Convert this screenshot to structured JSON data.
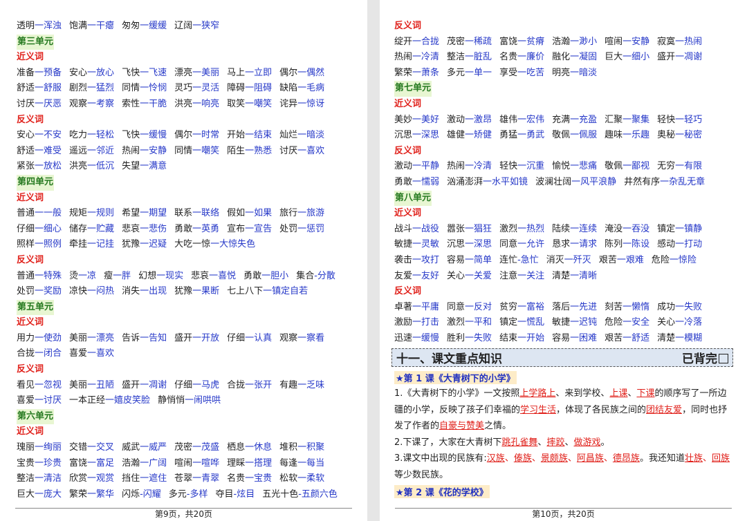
{
  "page9": {
    "footer": "第9页，共20页",
    "blocks": [
      {
        "kind": "words",
        "items": [
          [
            "透明",
            "一浑浊"
          ],
          [
            "饱满",
            "一干瘪"
          ],
          [
            "匆匆",
            "一缓缓"
          ],
          [
            "辽阔",
            "一狭窄"
          ]
        ]
      },
      {
        "kind": "unit",
        "text": "第三单元"
      },
      {
        "kind": "cat",
        "text": "近义词"
      },
      {
        "kind": "words",
        "items": [
          [
            "准备",
            "一预备"
          ],
          [
            "安心",
            "一放心"
          ],
          [
            "飞快",
            "一飞速"
          ],
          [
            "漂亮",
            "一美丽"
          ],
          [
            "马上",
            "一立即"
          ],
          [
            "偶尔",
            "一偶然"
          ]
        ]
      },
      {
        "kind": "words",
        "items": [
          [
            "舒适",
            "一舒服"
          ],
          [
            "剧烈",
            "一猛烈"
          ],
          [
            "同情",
            "一怜悯"
          ],
          [
            "灵巧",
            "一灵活"
          ],
          [
            "障碍",
            "一阻碍"
          ],
          [
            "缺陷",
            "一毛病"
          ]
        ]
      },
      {
        "kind": "words",
        "items": [
          [
            "讨厌",
            "一厌恶"
          ],
          [
            "观察",
            "一考察"
          ],
          [
            "索性",
            "一干脆"
          ],
          [
            "洪亮",
            "一响亮"
          ],
          [
            "取笑",
            "一嘲笑"
          ],
          [
            "诧异",
            "一惊讶"
          ]
        ]
      },
      {
        "kind": "cat",
        "text": "反义词"
      },
      {
        "kind": "words",
        "items": [
          [
            "安心",
            "一不安"
          ],
          [
            "吃力",
            "一轻松"
          ],
          [
            "飞快",
            "一缓慢"
          ],
          [
            "偶尔",
            "一时常"
          ],
          [
            "开始",
            "一结束"
          ],
          [
            "灿烂",
            "一暗淡"
          ]
        ]
      },
      {
        "kind": "words",
        "items": [
          [
            "舒适",
            "一难受"
          ],
          [
            "遥远",
            "一邻近"
          ],
          [
            "热闹",
            "一安静"
          ],
          [
            "同情",
            "一嘲笑"
          ],
          [
            "陌生",
            "一熟悉"
          ],
          [
            "讨厌",
            "一喜欢"
          ]
        ]
      },
      {
        "kind": "words",
        "items": [
          [
            "紧张",
            "一放松"
          ],
          [
            "洪亮",
            "一低沉"
          ],
          [
            "失望",
            "一满意"
          ]
        ]
      },
      {
        "kind": "unit",
        "text": "第四单元"
      },
      {
        "kind": "cat",
        "text": "近义词"
      },
      {
        "kind": "words",
        "items": [
          [
            "普通",
            "一一般"
          ],
          [
            "规矩",
            "一规则"
          ],
          [
            "希望",
            "一期望"
          ],
          [
            "联系",
            "一联络"
          ],
          [
            "假如",
            "一如果"
          ],
          [
            "旅行",
            "一旅游"
          ]
        ]
      },
      {
        "kind": "words",
        "items": [
          [
            "仔细",
            "一细心"
          ],
          [
            "储存",
            "一贮藏"
          ],
          [
            "悲哀",
            "一悲伤"
          ],
          [
            "勇敢",
            "一英勇"
          ],
          [
            "宣布",
            "一宣告"
          ],
          [
            "处罚",
            "一惩罚"
          ]
        ]
      },
      {
        "kind": "words",
        "items": [
          [
            "照样",
            "一照例"
          ],
          [
            "牵挂",
            "一记挂"
          ],
          [
            "犹豫",
            "一迟疑"
          ],
          [
            "大吃一惊",
            "一大惊失色"
          ]
        ]
      },
      {
        "kind": "cat",
        "text": "反义词"
      },
      {
        "kind": "words",
        "items": [
          [
            "普通",
            "一特殊"
          ],
          [
            "烫",
            "一凉"
          ],
          [
            "瘦",
            "一胖"
          ],
          [
            "幻想",
            "一现实"
          ],
          [
            "悲哀",
            "一喜悦"
          ],
          [
            "勇敢",
            "一胆小"
          ],
          [
            "集合",
            "-分散"
          ]
        ]
      },
      {
        "kind": "words",
        "items": [
          [
            "处罚",
            "一奖励"
          ],
          [
            "凉快",
            "一闷热"
          ],
          [
            "消失",
            "一出现"
          ],
          [
            "犹豫",
            "一果断"
          ],
          [
            "七上八下",
            "一镇定自若"
          ]
        ]
      },
      {
        "kind": "unit",
        "text": "第五单元"
      },
      {
        "kind": "cat",
        "text": "近义词"
      },
      {
        "kind": "words",
        "items": [
          [
            "用力",
            "一使劲"
          ],
          [
            "美丽",
            "一漂亮"
          ],
          [
            "告诉",
            "一告知"
          ],
          [
            "盛开",
            "一开放"
          ],
          [
            "仔细",
            "一认真"
          ],
          [
            "观察",
            "一察看"
          ]
        ]
      },
      {
        "kind": "words",
        "items": [
          [
            "合拢",
            "一闭合"
          ],
          [
            "喜爱",
            "一喜欢"
          ]
        ]
      },
      {
        "kind": "cat",
        "text": "反义词"
      },
      {
        "kind": "words",
        "items": [
          [
            "看见",
            "一忽视"
          ],
          [
            "美丽",
            "一丑陋"
          ],
          [
            "盛开",
            "一凋谢"
          ],
          [
            "仔细",
            "一马虎"
          ],
          [
            "合拢",
            "一张开"
          ],
          [
            "有趣",
            "一乏味"
          ]
        ]
      },
      {
        "kind": "words",
        "items": [
          [
            "喜爱",
            "一讨厌"
          ],
          [
            "一本正经",
            "一嬉皮笑脸"
          ],
          [
            "静悄悄",
            "一闹哄哄"
          ]
        ]
      },
      {
        "kind": "unit",
        "text": "第六单元"
      },
      {
        "kind": "cat",
        "text": "近义词"
      },
      {
        "kind": "words",
        "items": [
          [
            "瑰丽",
            "一绚丽"
          ],
          [
            "交错",
            "一交叉"
          ],
          [
            "威武",
            "一威严"
          ],
          [
            "茂密",
            "一茂盛"
          ],
          [
            "栖息",
            "一休息"
          ],
          [
            "堆积",
            "一积聚"
          ]
        ]
      },
      {
        "kind": "words",
        "items": [
          [
            "宝贵",
            "一珍贵"
          ],
          [
            "富饶",
            "一富足"
          ],
          [
            "浩瀚",
            "一广阔"
          ],
          [
            "喧闹",
            "一喧哗"
          ],
          [
            "理睬",
            "一搭理"
          ],
          [
            "每逢",
            "一每当"
          ]
        ]
      },
      {
        "kind": "words",
        "items": [
          [
            "整洁",
            "一清洁"
          ],
          [
            "欣赏",
            "一观赏"
          ],
          [
            "挡住",
            "一遮住"
          ],
          [
            "苍翠",
            "一青翠"
          ],
          [
            "名贵",
            "一宝贵"
          ],
          [
            "松软",
            "一柔软"
          ]
        ]
      },
      {
        "kind": "words",
        "items": [
          [
            "巨大",
            "一庞大"
          ],
          [
            "繁荣",
            "一繁华"
          ],
          [
            "闪烁",
            "-闪耀"
          ],
          [
            "多元",
            "-多样"
          ],
          [
            "夺目",
            "-炫目"
          ],
          [
            "五光十色",
            "-五颜六色"
          ]
        ]
      }
    ]
  },
  "page10": {
    "footer": "第10页，共20页",
    "blocks": [
      {
        "kind": "cat",
        "text": "反义词"
      },
      {
        "kind": "words",
        "items": [
          [
            "绽开",
            "一合拢"
          ],
          [
            "茂密",
            "一稀疏"
          ],
          [
            "富饶",
            "一贫瘠"
          ],
          [
            "浩瀚",
            "一渺小"
          ],
          [
            "喧闹",
            "一安静"
          ],
          [
            "寂寞",
            "一热闹"
          ]
        ]
      },
      {
        "kind": "words",
        "items": [
          [
            "热闹",
            "一冷清"
          ],
          [
            "整洁",
            "一脏乱"
          ],
          [
            "名贵",
            "一廉价"
          ],
          [
            "融化",
            "一凝固"
          ],
          [
            "巨大",
            "一细小"
          ],
          [
            "盛开",
            "一凋谢"
          ]
        ]
      },
      {
        "kind": "words",
        "items": [
          [
            "繁荣",
            "一萧条"
          ],
          [
            "多元",
            "一单一"
          ],
          [
            "享受",
            "一吃苦"
          ],
          [
            "明亮",
            "一暗淡"
          ]
        ]
      },
      {
        "kind": "unit",
        "text": "第七单元"
      },
      {
        "kind": "cat",
        "text": "近义词"
      },
      {
        "kind": "words",
        "items": [
          [
            "美妙",
            "一美好"
          ],
          [
            "激动",
            "一激昂"
          ],
          [
            "雄伟",
            "一宏伟"
          ],
          [
            "充满",
            "一充盈"
          ],
          [
            "汇聚",
            "一聚集"
          ],
          [
            "轻快",
            "一轻巧"
          ]
        ]
      },
      {
        "kind": "words",
        "items": [
          [
            "沉思",
            "一深思"
          ],
          [
            "雄健",
            "一矫健"
          ],
          [
            "勇猛",
            "一勇武"
          ],
          [
            "敬佩",
            "一佩服"
          ],
          [
            "趣味",
            "一乐趣"
          ],
          [
            "奥秘",
            "一秘密"
          ]
        ]
      },
      {
        "kind": "cat",
        "text": "反义词"
      },
      {
        "kind": "words",
        "items": [
          [
            "激动",
            "一平静"
          ],
          [
            "热闹",
            "一冷清"
          ],
          [
            "轻快",
            "一沉重"
          ],
          [
            "愉悦",
            "一悲痛"
          ],
          [
            "敬佩",
            "一鄙视"
          ],
          [
            "无穷",
            "一有限"
          ]
        ]
      },
      {
        "kind": "words",
        "items": [
          [
            "勇敢",
            "一懦弱"
          ],
          [
            "汹涌澎湃",
            "一水平如镜"
          ],
          [
            "波澜壮阔",
            "一风平浪静"
          ],
          [
            "井然有序",
            "一杂乱无章"
          ]
        ]
      },
      {
        "kind": "unit",
        "text": "第八单元"
      },
      {
        "kind": "cat",
        "text": "近义词"
      },
      {
        "kind": "words",
        "items": [
          [
            "战斗",
            "一战役"
          ],
          [
            "嚣张",
            "一猖狂"
          ],
          [
            "激烈",
            "一热烈"
          ],
          [
            "陆续",
            "一连续"
          ],
          [
            "淹没",
            "一吞没"
          ],
          [
            "镇定",
            "一镇静"
          ]
        ]
      },
      {
        "kind": "words",
        "items": [
          [
            "敏捷",
            "一灵敏"
          ],
          [
            "沉思",
            "一深思"
          ],
          [
            "同意",
            "一允许"
          ],
          [
            "恳求",
            "一请求"
          ],
          [
            "陈列",
            "一陈设"
          ],
          [
            "感动",
            "一打动"
          ]
        ]
      },
      {
        "kind": "words",
        "items": [
          [
            "袭击",
            "一攻打"
          ],
          [
            "容易",
            "一简单"
          ],
          [
            "连忙",
            "-急忙"
          ],
          [
            "消灭",
            "一歼灭"
          ],
          [
            "艰苦",
            "一艰难"
          ],
          [
            "危险",
            "一惊险"
          ]
        ]
      },
      {
        "kind": "words",
        "items": [
          [
            "友爱",
            "一友好"
          ],
          [
            "关心",
            "一关爱"
          ],
          [
            "注意",
            "一关注"
          ],
          [
            "清楚",
            "一清晰"
          ]
        ]
      },
      {
        "kind": "cat",
        "text": "反义词"
      },
      {
        "kind": "words",
        "items": [
          [
            "卓著",
            "一平庸"
          ],
          [
            "同意",
            "一反对"
          ],
          [
            "贫穷",
            "一富裕"
          ],
          [
            "落后",
            "一先进"
          ],
          [
            "刻苦",
            "一懒惰"
          ],
          [
            "成功",
            "一失败"
          ]
        ]
      },
      {
        "kind": "words",
        "items": [
          [
            "激励",
            "一打击"
          ],
          [
            "激烈",
            "一平和"
          ],
          [
            "镇定",
            "一慌乱"
          ],
          [
            "敏捷",
            "一迟钝"
          ],
          [
            "危险",
            "一安全"
          ],
          [
            "关心",
            "一冷落"
          ]
        ]
      },
      {
        "kind": "words",
        "items": [
          [
            "迅速",
            "一缓慢"
          ],
          [
            "胜利",
            "一失败"
          ],
          [
            "结束",
            "一开始"
          ],
          [
            "容易",
            "一困难"
          ],
          [
            "艰苦",
            "一舒适"
          ],
          [
            "清楚",
            "一模糊"
          ]
        ]
      }
    ],
    "section": {
      "title": "十一、课文重点知识",
      "checked": "已背完"
    },
    "lesson1": {
      "title": "★第 1 课《大青树下的小学》",
      "p1": {
        "a": "1.《大青树下的小学》一文按照",
        "b1": "上学路上",
        "c": "、来到学校、",
        "b2": "上课",
        "d": "、",
        "b3": "下课",
        "e": "的顺序写了一所边疆的小学，反映了孩子们幸福的",
        "b4": "学习生活",
        "f": "，体现了各民族之间的",
        "b5": "团结友爱",
        "g": "，同时也抒发了作者的",
        "b6": "自豪与赞美",
        "h": "之情。"
      },
      "p2": {
        "a": "2.下课了，大家在大青树下",
        "b1": "跳孔雀舞",
        "c": "、",
        "b2": "摔跤",
        "d": "、",
        "b3": "做游戏",
        "e": "。"
      },
      "p3": {
        "a": "3.课文中出现的民族有:",
        "b1": "汉族",
        "s1": "、",
        "b2": "傣族",
        "s2": "、",
        "b3": "景颇族",
        "s3": "、",
        "b4": "阿昌族",
        "s4": "、",
        "b5": "德昂族",
        "e": "。我还知道",
        "b6": "壮族",
        "s6": "、",
        "b7": "回族",
        "f": "等少数民族。"
      }
    },
    "lesson2": {
      "title": "★第 2 课《花的学校》"
    }
  }
}
